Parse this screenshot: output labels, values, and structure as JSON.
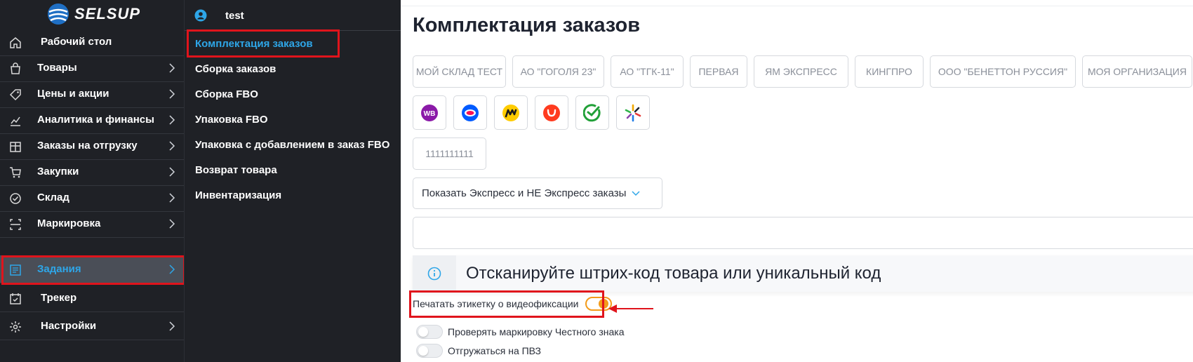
{
  "brand": {
    "name": "SELSUP"
  },
  "user": {
    "name": "test"
  },
  "sidebar": {
    "items": [
      {
        "label": "Рабочий стол",
        "icon": "home-icon",
        "chevron": false
      },
      {
        "label": "Товары",
        "icon": "bag-icon",
        "chevron": true
      },
      {
        "label": "Цены и акции",
        "icon": "price-tag-icon",
        "chevron": true
      },
      {
        "label": "Аналитика и финансы",
        "icon": "chart-line-icon",
        "chevron": true
      },
      {
        "label": "Заказы на отгрузку",
        "icon": "box-icon",
        "chevron": true
      },
      {
        "label": "Закупки",
        "icon": "cart-icon",
        "chevron": true
      },
      {
        "label": "Склад",
        "icon": "check-circle-icon",
        "chevron": true
      },
      {
        "label": "Маркировка",
        "icon": "scan-code-icon",
        "chevron": true
      },
      {
        "label": "Задания",
        "icon": "task-list-icon",
        "chevron": true,
        "active": true
      },
      {
        "label": "Трекер",
        "icon": "calendar-check-icon",
        "chevron": false
      },
      {
        "label": "Настройки",
        "icon": "gear-icon",
        "chevron": true
      }
    ]
  },
  "submenu": {
    "items": [
      {
        "label": "Комплектация заказов",
        "active": true
      },
      {
        "label": "Сборка заказов"
      },
      {
        "label": "Сборка FBO"
      },
      {
        "label": "Упаковка FBO"
      },
      {
        "label": "Упаковка с добавлением в заказ FBO"
      },
      {
        "label": "Возврат товара"
      },
      {
        "label": "Инвентаризация"
      }
    ]
  },
  "main": {
    "title": "Комплектация заказов",
    "organizations": [
      "МОЙ СКЛАД ТЕСТ",
      "АО \"ГОГОЛЯ 23\"",
      "АО \"ТГК-11\"",
      "ПЕРВАЯ",
      "ЯМ ЭКСПРЕСС",
      "КИНГПРО",
      "ООО \"БЕНЕТТОН РУССИЯ\"",
      "МОЯ ОРГАНИЗАЦИЯ"
    ],
    "marketplaces": [
      {
        "icon": "wildberries-icon",
        "text": "WB",
        "color": "#8b1aa8"
      },
      {
        "icon": "ozon-icon",
        "color": "#005bff"
      },
      {
        "icon": "yandex-market-icon",
        "color": "#ffcc00"
      },
      {
        "icon": "aliexpress-icon",
        "color": "#ff3b1f"
      },
      {
        "icon": "sbermegamarket-icon",
        "color": "#21a038"
      },
      {
        "icon": "multi-color-star-icon",
        "color": "#f2a900"
      }
    ],
    "extra_chip": "1111111111",
    "express_filter": {
      "value": "Показать Экспресс и НЕ Экспресс заказы"
    },
    "scan_input": {
      "value": ""
    },
    "scan_prompt": "Отсканируйте штрих-код товара или уникальный код",
    "toggles": [
      {
        "label": "Печатать этикетку о видеофиксации",
        "on": true
      },
      {
        "label": "Проверять маркировку Честного знака",
        "on": false
      },
      {
        "label": "Отгружаться на ПВЗ",
        "on": false
      }
    ]
  },
  "colors": {
    "sidebar_bg": "#1f2126",
    "accent": "#2ea6e8",
    "highlight_frame": "#e0141c",
    "toggle_on": "#f39b1a"
  }
}
